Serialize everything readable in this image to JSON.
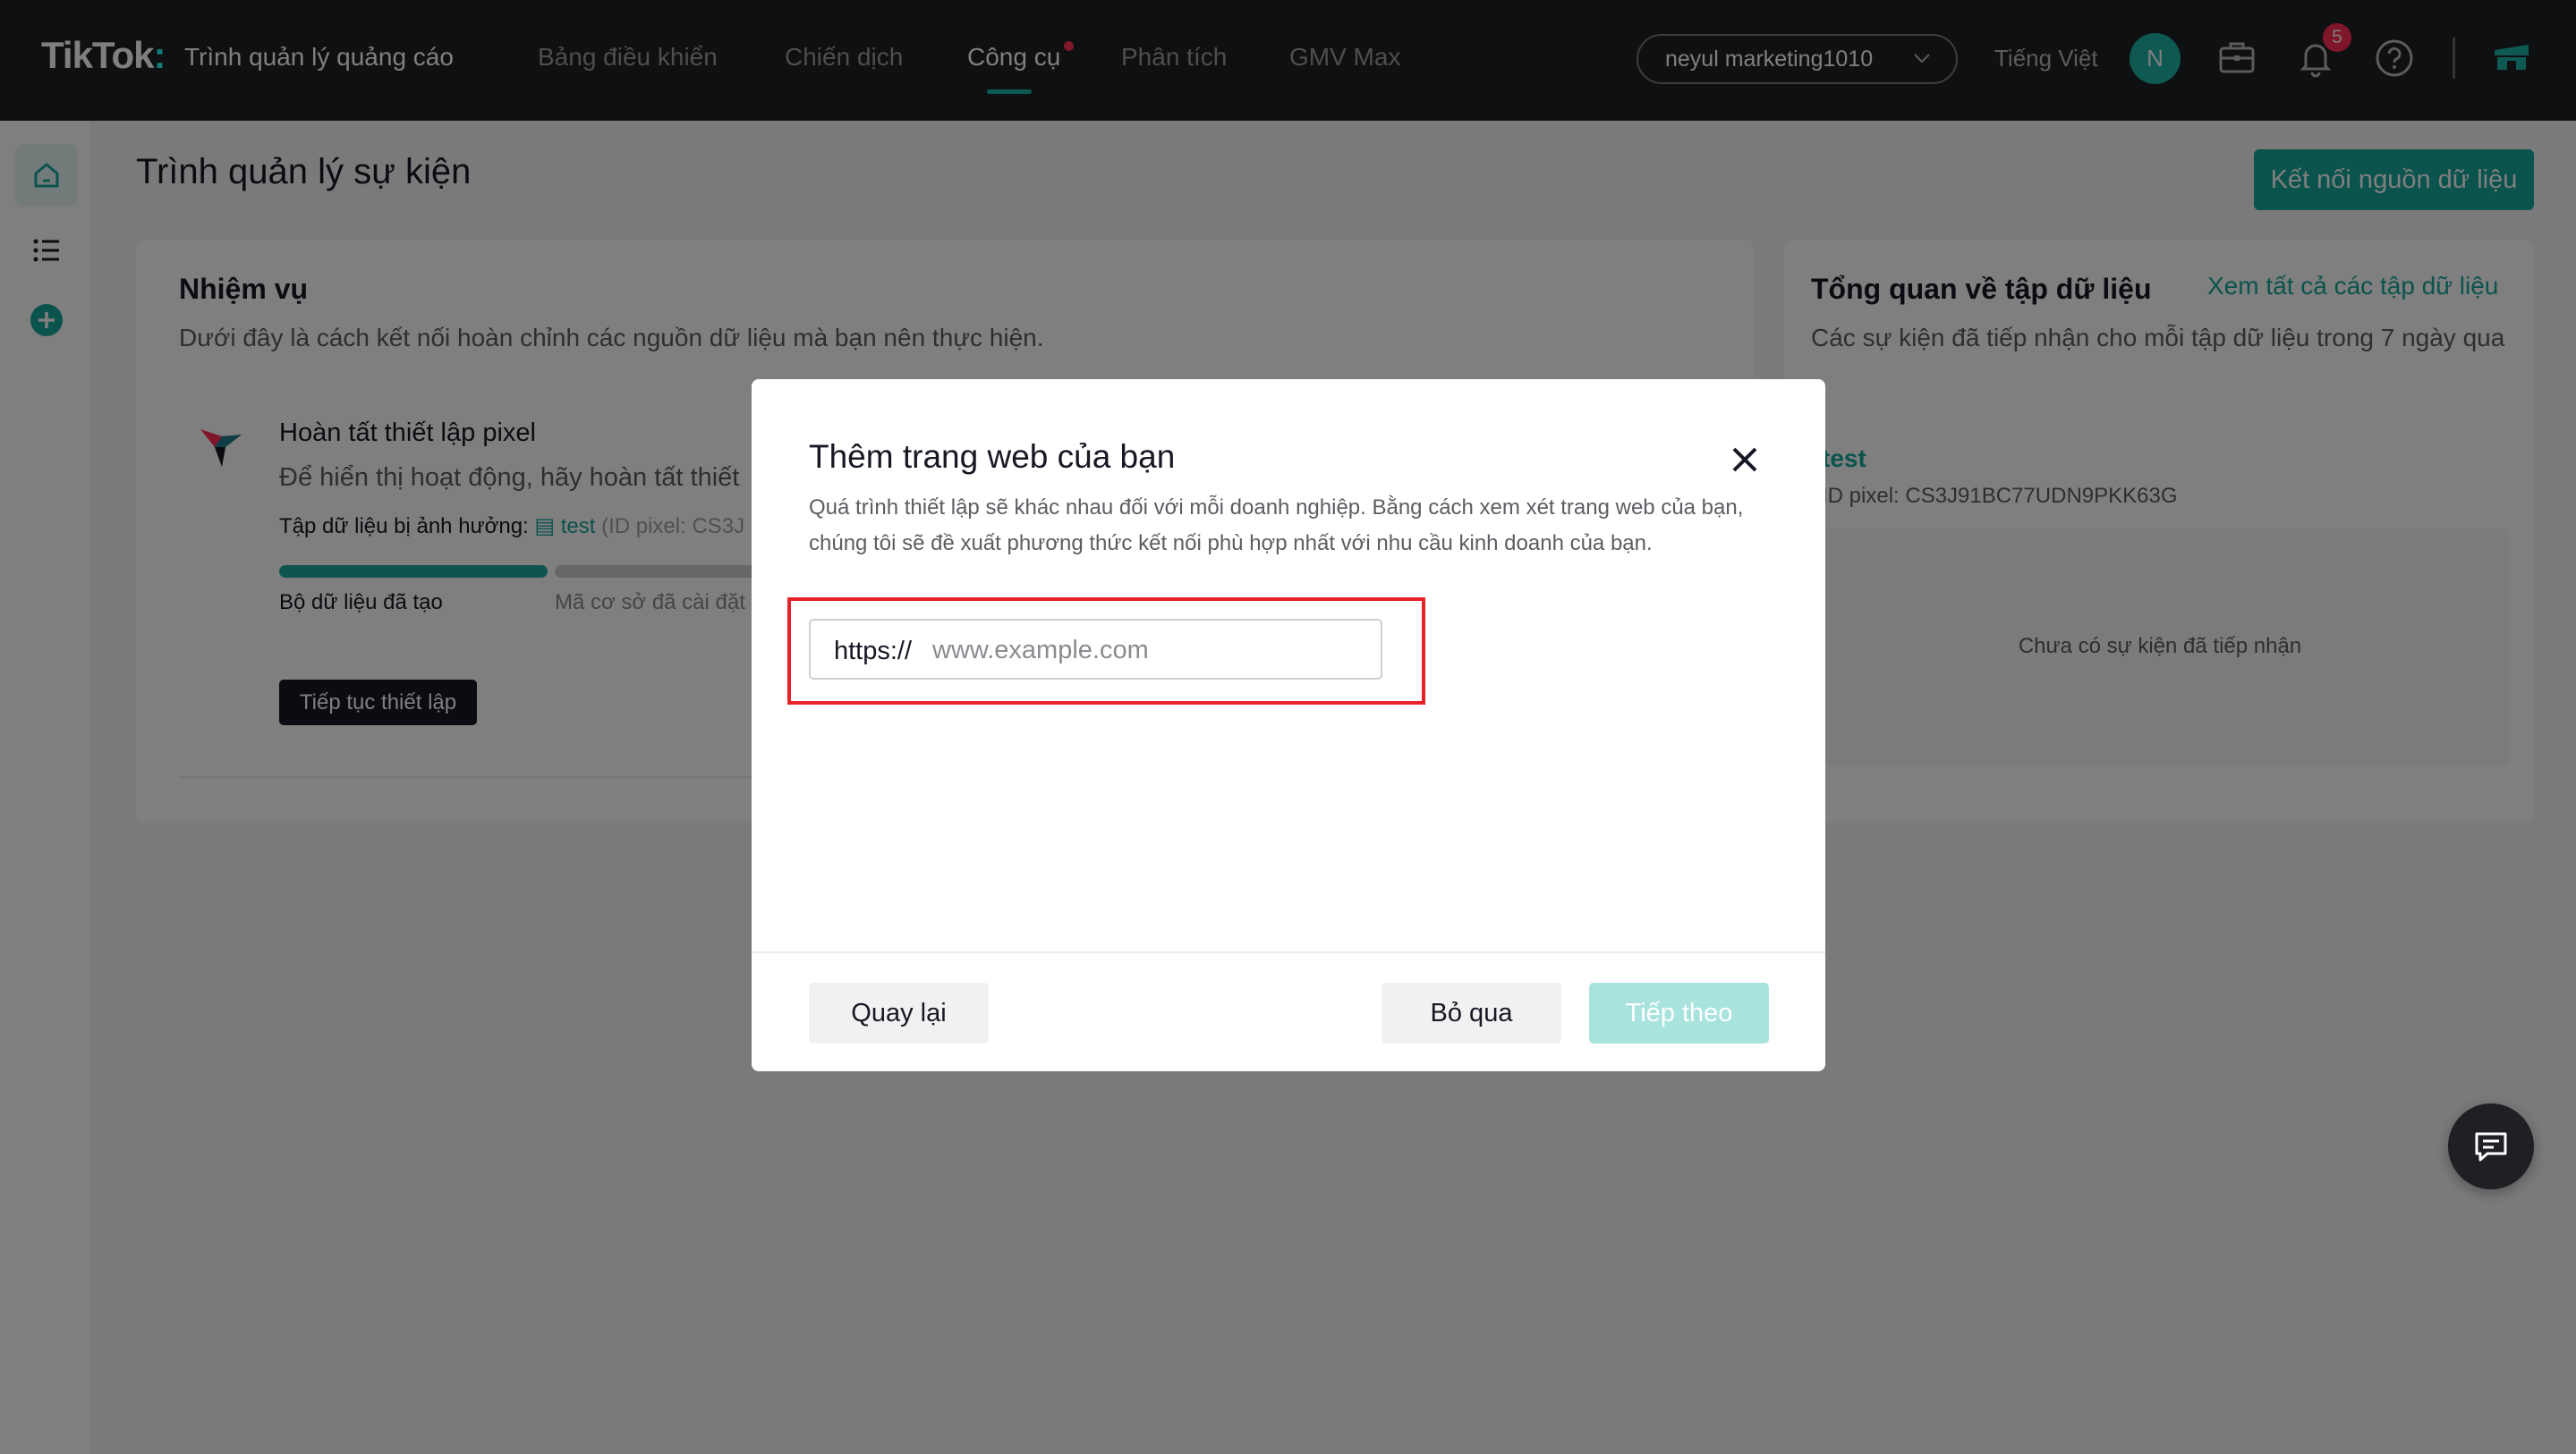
{
  "header": {
    "logo_text": "TikTok",
    "logo_suffix": ":",
    "product_name": "Trình quản lý quảng cáo",
    "nav": [
      {
        "label": "Bảng điều khiển",
        "active": false
      },
      {
        "label": "Chiến dịch",
        "active": false
      },
      {
        "label": "Công cụ",
        "active": true,
        "has_dot": true
      },
      {
        "label": "Phân tích",
        "active": false
      },
      {
        "label": "GMV Max",
        "active": false
      }
    ],
    "account": "neyul marketing1010",
    "language": "Tiếng Việt",
    "avatar_initial": "N",
    "notification_count": "5",
    "icons": [
      "briefcase-icon",
      "bell-icon",
      "help-icon",
      "storefront-icon"
    ]
  },
  "sidebar": {
    "items": [
      "home-icon",
      "list-icon",
      "add-icon"
    ]
  },
  "page": {
    "title": "Trình quản lý sự kiện",
    "connect_button": "Kết nối nguồn dữ liệu"
  },
  "tasks_card": {
    "title": "Nhiệm vụ",
    "subtitle": "Dưới đây là cách kết nối hoàn chỉnh các nguồn dữ liệu mà bạn nên thực hiện.",
    "task": {
      "title": "Hoàn tất thiết lập pixel",
      "description": "Để hiển thị hoạt động, hãy hoàn tất thiết",
      "affected_label": "Tập dữ liệu bị ảnh hưởng:",
      "affected_link": "test",
      "affected_id": "(ID pixel: CS3J",
      "step_1": "Bộ dữ liệu đã tạo",
      "step_2": "Mã cơ sở đã cài đặt",
      "continue_button": "Tiếp tục thiết lập"
    }
  },
  "dataset_card": {
    "title": "Tổng quan về tập dữ liệu",
    "view_all": "Xem tất cả các tập dữ liệu",
    "subtitle": "Các sự kiện đã tiếp nhận cho mỗi tập dữ liệu trong 7 ngày qua",
    "dataset_name": "test",
    "dataset_id": "ID pixel: CS3J91BC77UDN9PKK63G",
    "empty_text": "Chưa có sự kiện đã tiếp nhận"
  },
  "modal": {
    "title": "Thêm trang web của bạn",
    "description": "Quá trình thiết lập sẽ khác nhau đối với mỗi doanh nghiệp. Bằng cách xem xét trang web của bạn, chúng tôi sẽ đề xuất phương thức kết nối phù hợp nhất với nhu cầu kinh doanh của bạn.",
    "url_prefix": "https://",
    "url_placeholder": "www.example.com",
    "url_value": "",
    "back_button": "Quay lại",
    "skip_button": "Bỏ qua",
    "next_button": "Tiếp theo",
    "next_disabled": true
  },
  "colors": {
    "accent": "#16a69a",
    "header_bg": "#1f2023",
    "highlight": "#e8222a",
    "badge": "#fe2c55"
  }
}
